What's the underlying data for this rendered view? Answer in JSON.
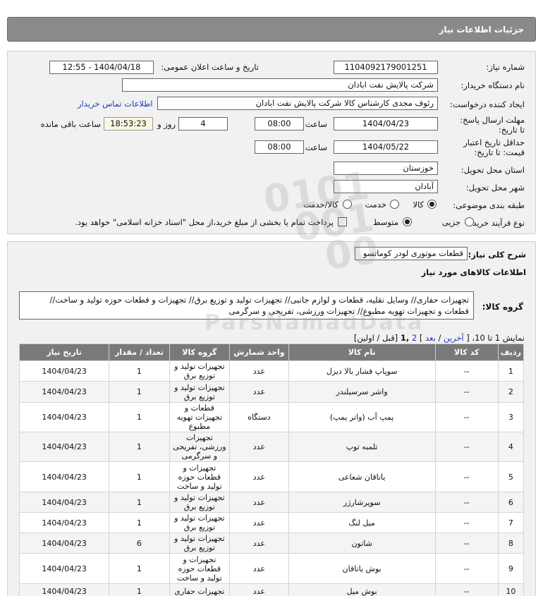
{
  "header": {
    "title": "جزئیات اطلاعات نیاز"
  },
  "form": {
    "need_number_label": "شماره نیاز:",
    "need_number": "1104092179001251",
    "announce_label": "تاریخ و ساعت اعلان عمومی:",
    "announce_value": "1404/04/18 - 12:55",
    "buyer_org_label": "نام دستگاه خریدار:",
    "buyer_org": "شرکت پالایش نفت ابادان",
    "creator_label": "ایجاد کننده درخواست:",
    "creator": "رئوف مجدی کارشناس کالا شرکت پالایش نفت ابادان",
    "contact_link": "اطلاعات تماس خریدار",
    "reply_label": "مهلت ارسال پاسخ: تا تاریخ:",
    "reply_date": "1404/04/23",
    "time_label": "ساعت",
    "reply_time": "08:00",
    "days": "4",
    "days_label": "روز و",
    "remaining": "18:53:23",
    "remaining_label": "ساعت باقی مانده",
    "validity_label": "حداقل تاریخ اعتبار قیمت: تا تاریخ:",
    "validity_date": "1404/05/22",
    "validity_time": "08:00",
    "province_label": "استان محل تحویل:",
    "province": "خوزستان",
    "city_label": "شهر محل تحویل:",
    "city": "آبادان",
    "category_label": "طبقه بندی موضوعی:",
    "cat_goods": "کالا",
    "cat_service": "خدمت",
    "cat_both": "کالا/خدمت",
    "purchase_label": "نوع فرآیند خرید :",
    "p_small": "جزیی",
    "p_medium": "متوسط",
    "payment_note": "پرداخت تمام یا بخشی از مبلغ خرید،از محل \"اسناد خزانه اسلامی\" خواهد بود."
  },
  "details": {
    "summary_label": "شرح کلی نیاز:",
    "summary": "قطعات موتوری لودر کوماتسو",
    "goods_info_title": "اطلاعات کالاهای مورد نیاز",
    "group_label": "گروه کالا:",
    "group_text": "تجهیزات حفاری// وسایل نقلیه، قطعات و لوازم جانبی// تجهیزات تولید و توزیع برق// تجهیزات و قطعات حوزه تولید و ساخت// قطعات و تجهیزات تهویه مطبوع// تجهیزات ورزشی، تفریحی و سرگرمی",
    "pagination": {
      "prefix": "نمایش 1 تا 10،",
      "bracket_open": "[",
      "last": "آخرین",
      "slash1": "/",
      "next": "بعد",
      "bracket_close": "]",
      "page2": "2",
      "page1": ",1",
      "rest": "[قبل / اولین]"
    },
    "columns": [
      "ردیف",
      "کد کالا",
      "نام کالا",
      "واحد شمارش",
      "گروه کالا",
      "تعداد / مقدار",
      "تاریخ نیاز"
    ],
    "rows": [
      [
        "1",
        "--",
        "سوپاپ فشار بالا دیزل",
        "عدد",
        "تجهیزات تولید و توزیع برق",
        "1",
        "1404/04/23"
      ],
      [
        "2",
        "--",
        "واشر سرسیلندر",
        "عدد",
        "تجهیزات تولید و توزیع برق",
        "1",
        "1404/04/23"
      ],
      [
        "3",
        "--",
        "پمپ آب (واتر پمپ)",
        "دستگاه",
        "قطعات و تجهیزات تهویه مطبوع",
        "1",
        "1404/04/23"
      ],
      [
        "4",
        "--",
        "تلمبه توپ",
        "عدد",
        "تجهیزات ورزشی، تفریحی و سرگرمی",
        "1",
        "1404/04/23"
      ],
      [
        "5",
        "--",
        "یاتاقان شعاعی",
        "عدد",
        "تجهیزات و قطعات حوزه تولید و ساخت",
        "1",
        "1404/04/23"
      ],
      [
        "6",
        "--",
        "سوپرشارژر",
        "عدد",
        "تجهیزات تولید و توزیع برق",
        "1",
        "1404/04/23"
      ],
      [
        "7",
        "--",
        "میل لنگ",
        "عدد",
        "تجهیزات تولید و توزیع برق",
        "1",
        "1404/04/23"
      ],
      [
        "8",
        "--",
        "شاتون",
        "عدد",
        "تجهیزات تولید و توزیع برق",
        "6",
        "1404/04/23"
      ],
      [
        "9",
        "--",
        "بوش یاتاقان",
        "عدد",
        "تجهیزات و قطعات حوزه تولید و ساخت",
        "1",
        "1404/04/23"
      ],
      [
        "10",
        "--",
        "بوش میل",
        "عدد",
        "تجهیزات حفاری",
        "1",
        "1404/04/23"
      ]
    ]
  }
}
